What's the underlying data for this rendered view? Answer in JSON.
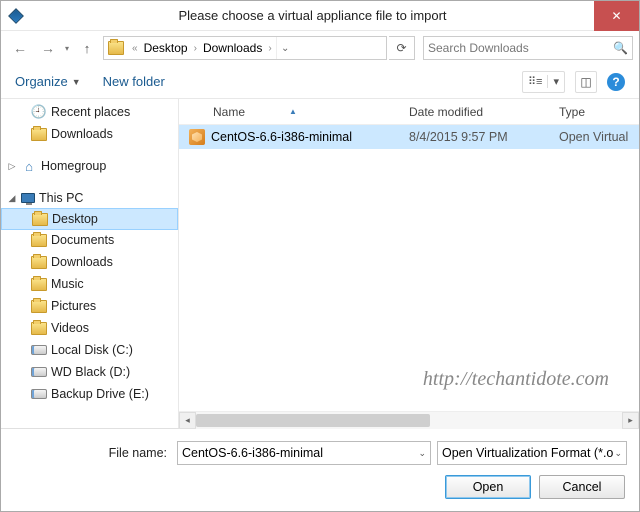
{
  "title": "Please choose a virtual appliance file to import",
  "breadcrumb": {
    "a": "Desktop",
    "b": "Downloads"
  },
  "search_placeholder": "Search Downloads",
  "toolbar": {
    "organize": "Organize",
    "newfolder": "New folder"
  },
  "sidebar": {
    "recent": "Recent places",
    "downloads_fav": "Downloads",
    "homegroup": "Homegroup",
    "thispc": "This PC",
    "desktop": "Desktop",
    "documents": "Documents",
    "downloads": "Downloads",
    "music": "Music",
    "pictures": "Pictures",
    "videos": "Videos",
    "localdisk": "Local Disk (C:)",
    "wdblack": "WD Black (D:)",
    "backup": "Backup Drive (E:)"
  },
  "columns": {
    "name": "Name",
    "date": "Date modified",
    "type": "Type"
  },
  "file": {
    "name": "CentOS-6.6-i386-minimal",
    "date": "8/4/2015 9:57 PM",
    "type": "Open Virtual"
  },
  "footer": {
    "filename_label": "File name:",
    "filename_value": "CentOS-6.6-i386-minimal",
    "filter": "Open Virtualization Format (*.o",
    "open": "Open",
    "cancel": "Cancel"
  },
  "watermark": "http://techantidote.com"
}
